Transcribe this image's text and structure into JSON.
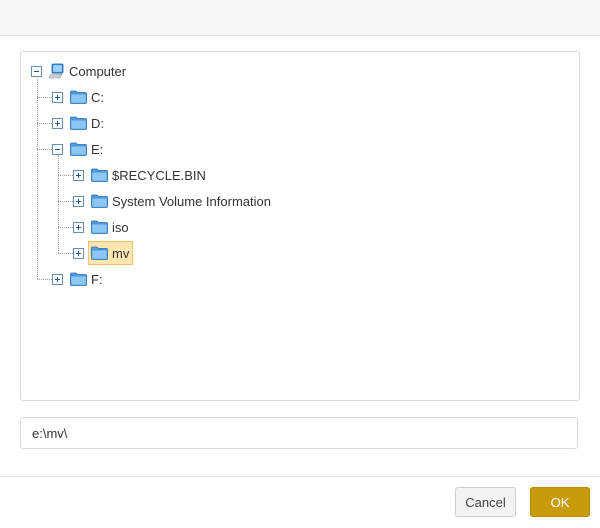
{
  "tree": {
    "root": {
      "label": "Computer",
      "icon": "computer-icon",
      "expanded": true
    },
    "nodes": [
      {
        "label": "C:",
        "icon": "folder-icon",
        "expanded": false
      },
      {
        "label": "D:",
        "icon": "folder-icon",
        "expanded": false
      },
      {
        "label": "E:",
        "icon": "folder-icon",
        "expanded": true,
        "children": [
          {
            "label": "$RECYCLE.BIN",
            "icon": "folder-icon",
            "expanded": false
          },
          {
            "label": "System Volume Information",
            "icon": "folder-icon",
            "expanded": false
          },
          {
            "label": "iso",
            "icon": "folder-icon",
            "expanded": false
          },
          {
            "label": "mv",
            "icon": "folder-icon",
            "expanded": false,
            "selected": true
          }
        ]
      },
      {
        "label": "F:",
        "icon": "folder-icon",
        "expanded": false
      }
    ]
  },
  "path_input": {
    "value": "e:\\mv\\"
  },
  "buttons": {
    "cancel": "Cancel",
    "ok": "OK"
  },
  "colors": {
    "selection_bg": "#ffe6b0",
    "selection_border": "#f3c46f",
    "ok_button": "#c89a0c",
    "folder": "#5aa6e6"
  }
}
